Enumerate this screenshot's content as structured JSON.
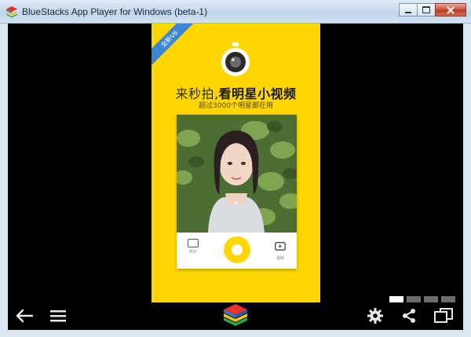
{
  "window": {
    "title": "BlueStacks App Player for Windows (beta-1)",
    "icon": "bluestacks-logo-icon",
    "controls": [
      "minimize-icon",
      "maximize-icon",
      "close-icon"
    ]
  },
  "app": {
    "ribbon": "全新V6",
    "headline_prefix": "来秒拍,",
    "headline_bold": "看明星小视频",
    "subline": "超过3000个明星都在用",
    "card": {
      "left_action_label": "照片",
      "right_action_label": "视频"
    }
  },
  "pager": {
    "count": 4,
    "active_index": 0
  },
  "bottom_nav": {
    "left": [
      "back-arrow-icon",
      "menu-icon"
    ],
    "center": "bluestacks-logo-icon",
    "right": [
      "settings-gear-icon",
      "share-icon",
      "fullscreen-toggle-icon"
    ]
  },
  "colors": {
    "app_background": "#fed603",
    "ribbon": "#3c86d6",
    "player_background": "#000000",
    "titlebar": "#c9dbef"
  }
}
